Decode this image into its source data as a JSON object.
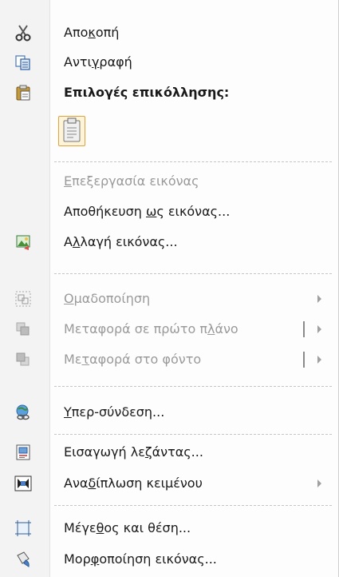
{
  "menu": {
    "items": [
      {
        "label_parts": [
          "Απο",
          "κ",
          "οπή"
        ],
        "icon": "scissors-icon"
      },
      {
        "label_parts": [
          "Αντι",
          "γ",
          "ραφή"
        ],
        "icon": "copy-icon"
      },
      {
        "label": "Επιλογές επικόλλησης:",
        "icon": "paste-icon"
      },
      {
        "label_parts": [
          "",
          "Ε",
          "πεξεργασία εικόνας"
        ],
        "state": "disabled"
      },
      {
        "label_parts": [
          "Αποθήκευση ",
          "ω",
          "ς εικόνας..."
        ]
      },
      {
        "label_parts": [
          "Α",
          "λ",
          "λαγή εικόνας..."
        ],
        "icon": "change-picture-icon"
      },
      {
        "label_parts": [
          "",
          "Ο",
          "μαδοποίηση"
        ],
        "state": "disabled",
        "icon": "group-icon",
        "submenu": true
      },
      {
        "label_parts": [
          "Μεταφορά σε πρώτο π",
          "λ",
          "άνο"
        ],
        "state": "disabled",
        "icon": "bring-to-front-icon",
        "submenu": true
      },
      {
        "label_parts": [
          "Με",
          "τ",
          "αφορά στο φόντο"
        ],
        "state": "disabled",
        "icon": "send-to-back-icon",
        "submenu": true
      },
      {
        "label_parts": [
          "",
          "Υ",
          "περ-σύνδεση..."
        ],
        "icon": "hyperlink-icon"
      },
      {
        "label_parts": [
          "Εισαγωγή λε",
          "ζ",
          "άντας..."
        ],
        "icon": "insert-caption-icon"
      },
      {
        "label_parts": [
          "Ανα",
          "δ",
          "ίπλωση κειμένου"
        ],
        "icon": "wrap-text-icon",
        "submenu": true
      },
      {
        "label_parts": [
          "Μέγε",
          "θ",
          "ος και θέση..."
        ],
        "icon": "size-position-icon"
      },
      {
        "label_parts": [
          "Μορ",
          "φ",
          "οποίηση εικόνας..."
        ],
        "icon": "format-picture-icon"
      }
    ],
    "paste_option": "keep-source-formatting-icon"
  }
}
